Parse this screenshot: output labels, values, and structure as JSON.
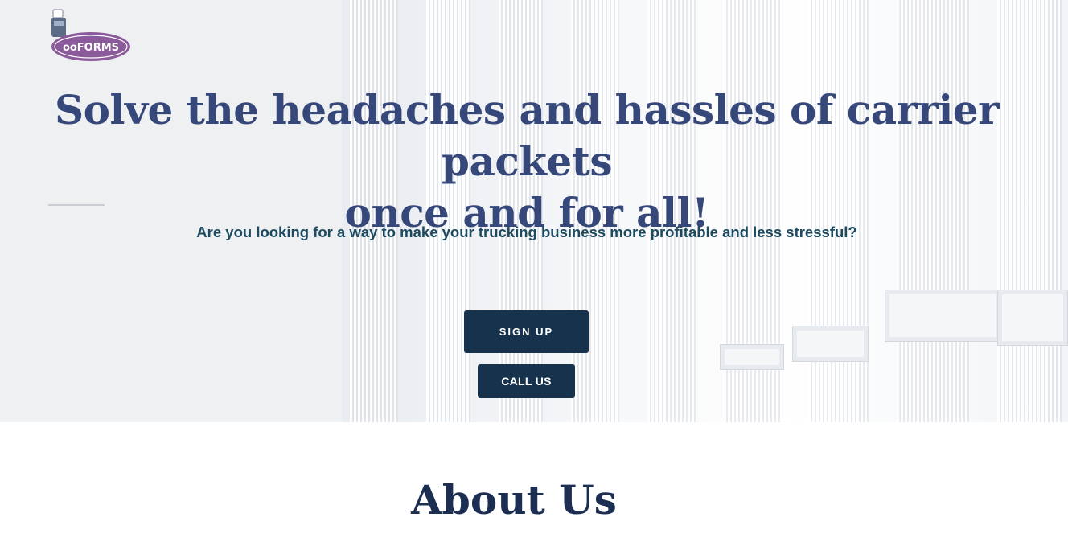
{
  "brand": {
    "logo_text": "ooFORMS",
    "logo_color": "#8b5a9a"
  },
  "hero": {
    "headline_line1": "Solve the headaches and hassles of carrier packets",
    "headline_line2": "once and for all!",
    "subheadline": "Are you looking for a way to make your trucking business more profitable and less stressful?",
    "headline_color": "#36487a",
    "subheadline_color": "#1c4a5f"
  },
  "buttons": {
    "signup_label": "SIGN UP",
    "call_label": "CALL US",
    "color": "#16324d"
  },
  "about": {
    "title": "About Us"
  }
}
